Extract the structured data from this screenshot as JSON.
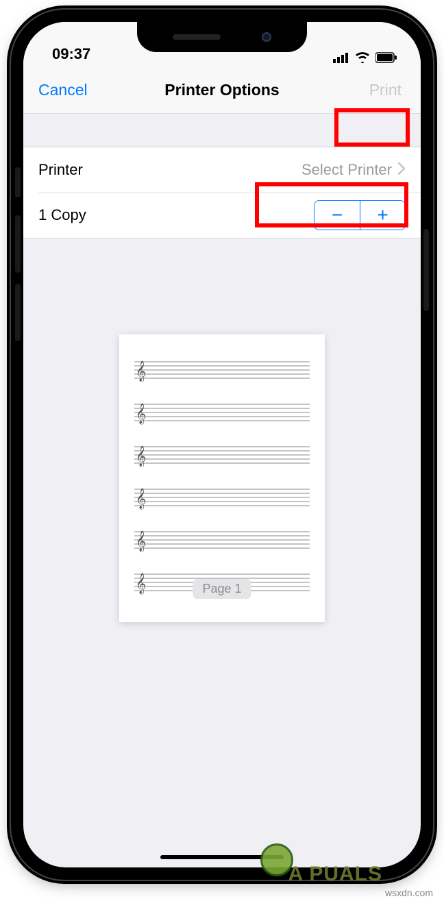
{
  "status": {
    "time": "09:37"
  },
  "nav": {
    "cancel": "Cancel",
    "title": "Printer Options",
    "print": "Print"
  },
  "rows": {
    "printer_label": "Printer",
    "printer_value": "Select Printer",
    "copies_label": "1 Copy"
  },
  "stepper": {
    "minus": "−",
    "plus": "+"
  },
  "preview": {
    "page_label": "Page 1"
  },
  "watermark": "wsxdn.com",
  "brand": "A PUALS"
}
